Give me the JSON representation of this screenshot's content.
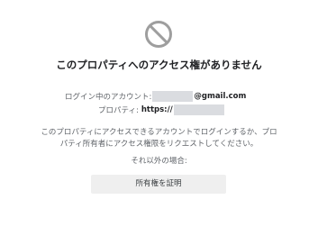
{
  "icon": "no-entry-icon",
  "colors": {
    "icon": "#9e9e9e",
    "title": "#202124",
    "secondary_text": "#5f6368",
    "redaction": "#dadce0",
    "button_bg": "#efefef"
  },
  "title": "このプロパティへのアクセス権がありません",
  "account": {
    "label": "ログイン中のアカウント:",
    "email_suffix": "@gmail.com"
  },
  "property": {
    "label": "プロパティ:",
    "url_prefix": "https://"
  },
  "description": {
    "line1": "このプロパティにアクセスできるアカウントでログインするか、プロ",
    "line2": "パティ所有者にアクセス権限をリクエストしてください。"
  },
  "otherwise_label": "それ以外の場合:",
  "verify_button_label": "所有権を証明"
}
